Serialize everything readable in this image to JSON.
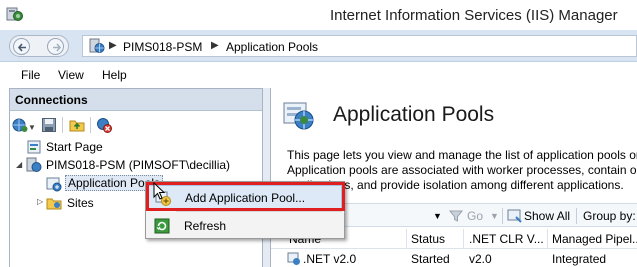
{
  "window": {
    "title": "Internet Information Services (IIS) Manager"
  },
  "address": {
    "crumbs": [
      "PIMS018-PSM",
      "Application Pools"
    ]
  },
  "menu": {
    "items": [
      "File",
      "View",
      "Help"
    ]
  },
  "connections": {
    "header": "Connections",
    "tree": {
      "start_page": "Start Page",
      "server": "PIMS018-PSM (PIMSOFT\\decillia)",
      "app_pools": "Application Pools",
      "sites": "Sites"
    }
  },
  "main": {
    "title": "Application Pools",
    "description": [
      "This page lets you view and manage the list of application pools or",
      "Application pools are associated with worker processes, contain on",
      "applications, and provide isolation among different applications."
    ],
    "filter": {
      "go": "Go",
      "show_all": "Show All",
      "group_by": "Group by:"
    },
    "columns": [
      "Name",
      "Status",
      ".NET CLR V...",
      "Managed Pipel..."
    ],
    "rows": [
      {
        "name": ".NET v2.0",
        "status": "Started",
        "clr": "v2.0",
        "pipeline": "Integrated"
      }
    ]
  },
  "context_menu": {
    "items": [
      "Add Application Pool...",
      "Refresh"
    ],
    "highlighted": "Add Application Pool..."
  },
  "colors": {
    "highlight_box": "#e02020",
    "header_bg": "#d5dfeb",
    "address_bg": "#d9e4f2"
  }
}
